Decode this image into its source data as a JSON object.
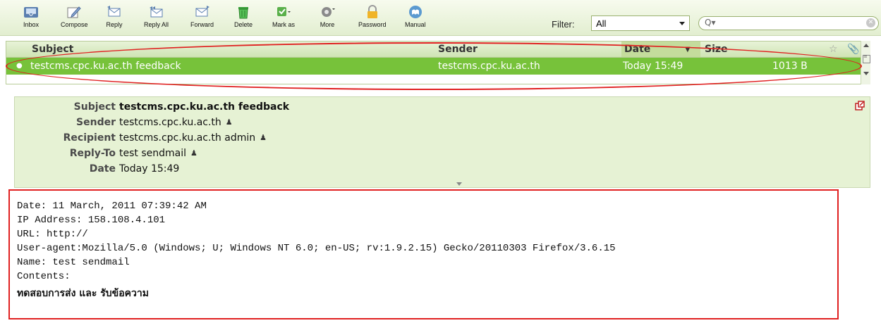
{
  "toolbar": {
    "buttons": [
      {
        "label": "Inbox",
        "icon": "inbox-icon"
      },
      {
        "label": "Compose",
        "icon": "compose-icon"
      },
      {
        "label": "Reply",
        "icon": "reply-icon"
      },
      {
        "label": "Reply All",
        "icon": "reply-all-icon"
      },
      {
        "label": "Forward",
        "icon": "forward-icon"
      },
      {
        "label": "Delete",
        "icon": "delete-icon"
      },
      {
        "label": "Mark as",
        "icon": "mark-as-icon"
      },
      {
        "label": "More",
        "icon": "more-icon"
      },
      {
        "label": "Password",
        "icon": "password-icon"
      },
      {
        "label": "Manual",
        "icon": "manual-icon"
      }
    ],
    "filter_label": "Filter:",
    "filter_value": "All",
    "search_placeholder": ""
  },
  "message_list": {
    "columns": {
      "subject": "Subject",
      "sender": "Sender",
      "date": "Date",
      "size": "Size"
    },
    "rows": [
      {
        "subject": "testcms.cpc.ku.ac.th feedback",
        "sender": "testcms.cpc.ku.ac.th",
        "date": "Today 15:49",
        "size": "1013 B"
      }
    ]
  },
  "headers": {
    "subject_label": "Subject",
    "subject_value": "testcms.cpc.ku.ac.th feedback",
    "sender_label": "Sender",
    "sender_value": "testcms.cpc.ku.ac.th",
    "recipient_label": "Recipient",
    "recipient_value": "testcms.cpc.ku.ac.th admin",
    "replyto_label": "Reply-To",
    "replyto_value": "test sendmail",
    "date_label": "Date",
    "date_value": "Today 15:49"
  },
  "body": {
    "lines": [
      "Date: 11 March, 2011 07:39:42 AM",
      "IP Address: 158.108.4.101",
      "URL: http://",
      "User-agent:Mozilla/5.0 (Windows; U; Windows NT 6.0; en-US; rv:1.9.2.15) Gecko/20110303 Firefox/3.6.15",
      "Name: test sendmail",
      "Contents:"
    ],
    "thai_line": "ทดสอบการส่ง และ รับข้อความ"
  },
  "colors": {
    "selected_row": "#77c23a",
    "highlight": "#e02020",
    "header_panel": "#e6f2d4"
  }
}
